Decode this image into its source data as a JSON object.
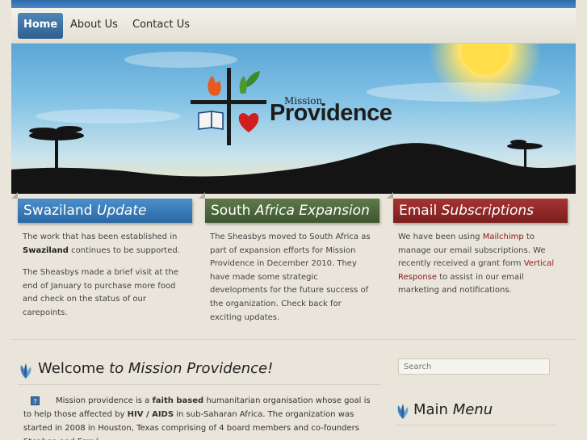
{
  "nav": {
    "items": [
      {
        "label": "Home",
        "active": true
      },
      {
        "label": "About Us",
        "active": false
      },
      {
        "label": "Contact Us",
        "active": false
      }
    ]
  },
  "banner": {
    "logo_small": "Mission",
    "logo_main": "Providence"
  },
  "columns": [
    {
      "title_plain": "Swaziland",
      "title_italic": "Update",
      "color": "#3a7cb8",
      "paragraphs": [
        {
          "pre": "The work that has been established in ",
          "bold": "Swaziland",
          "post": " continues to be supported."
        },
        {
          "pre": "The Sheasbys made a brief visit at the end of January to purchase more food and check on the status of our carepoints.",
          "bold": "",
          "post": ""
        }
      ]
    },
    {
      "title_plain": "South",
      "title_italic": "Africa Expansion",
      "color": "#4e6a3c",
      "text": "The Sheasbys moved to South Africa as part of expansion efforts for Mission Providence in December 2010. They have made some strategic developments for the future success of the organization. Check back for exciting updates."
    },
    {
      "title_plain": "Email",
      "title_italic": "Subscriptions",
      "color": "#922a2a",
      "text_pre": "We have been using ",
      "link1": "Mailchimp",
      "text_mid": " to manage our email subscriptions. We recently received a grant form ",
      "link2": "Vertical Response",
      "text_post": " to assist in our email marketing and notifications."
    }
  ],
  "welcome": {
    "title_plain": "Welcome",
    "title_italic": "to Mission Providence!",
    "body_pre": "Mission providence is a ",
    "body_bold1": "faith based",
    "body_mid1": " humanitarian organisation whose goal is to help those affected by ",
    "body_bold2": "HIV / AIDS",
    "body_mid2": " in sub-Saharan Africa. The organization was started in 2008 in Houston, Texas comprising of 4 board members and co-founders Stephen and Esmé",
    "icon": "?"
  },
  "sidebar": {
    "search_placeholder": "Search",
    "menu_plain": "Main",
    "menu_italic": "Menu"
  },
  "colors": {
    "nav_active": "#3a6fa0",
    "link": "#8a1a1a",
    "background": "#e9e5da"
  }
}
